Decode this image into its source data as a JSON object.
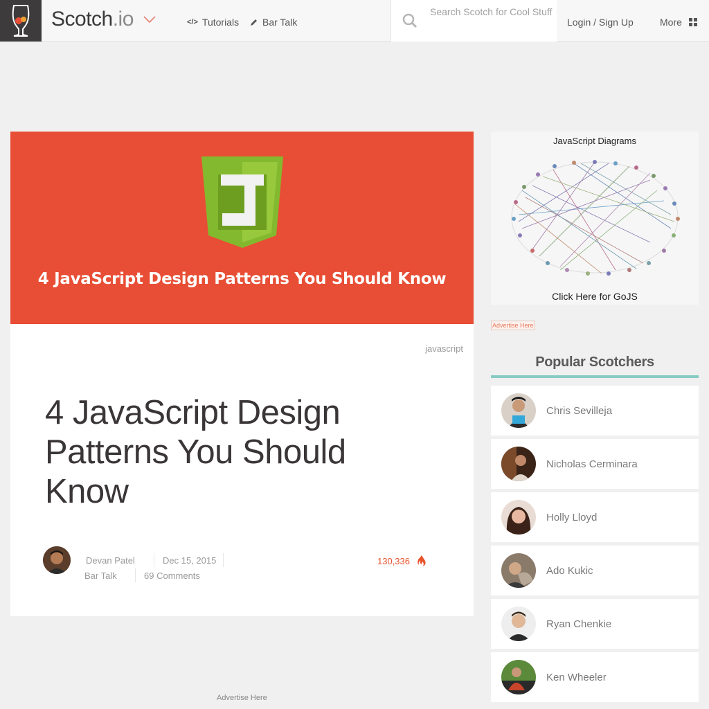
{
  "header": {
    "brand": "Scotch",
    "brand_suffix": ".io",
    "nav": [
      {
        "label": "Tutorials",
        "icon": "code-icon"
      },
      {
        "label": "Bar Talk",
        "icon": "pencil-icon"
      }
    ],
    "search_placeholder": "Search Scotch for Cool Stuff",
    "login_label": "Login / Sign Up",
    "more_label": "More"
  },
  "article": {
    "hero_text": "4 JavaScript Design Patterns You Should Know",
    "tag": "javascript",
    "title": "4 JavaScript Design Patterns You Should Know",
    "author": "Devan Patel",
    "date": "Dec 15, 2015",
    "category": "Bar Talk",
    "comments": "69 Comments",
    "views": "130,336"
  },
  "ads": {
    "bottom_label": "Advertise Here",
    "sidebar_label": "Advertise Here",
    "diagram_title": "JavaScript Diagrams",
    "diagram_cta": "Click  Here  for GoJS"
  },
  "sidebar": {
    "title": "Popular Scotchers",
    "scotchers": [
      {
        "name": "Chris Sevilleja"
      },
      {
        "name": "Nicholas Cerminara"
      },
      {
        "name": "Holly Lloyd"
      },
      {
        "name": "Ado Kukic"
      },
      {
        "name": "Ryan Chenkie"
      },
      {
        "name": "Ken Wheeler"
      }
    ]
  },
  "colors": {
    "hero": "#e84e35",
    "accent_views": "#e8532b",
    "popular_underline": "#87cbc3",
    "js_shield": "#83b92e"
  }
}
